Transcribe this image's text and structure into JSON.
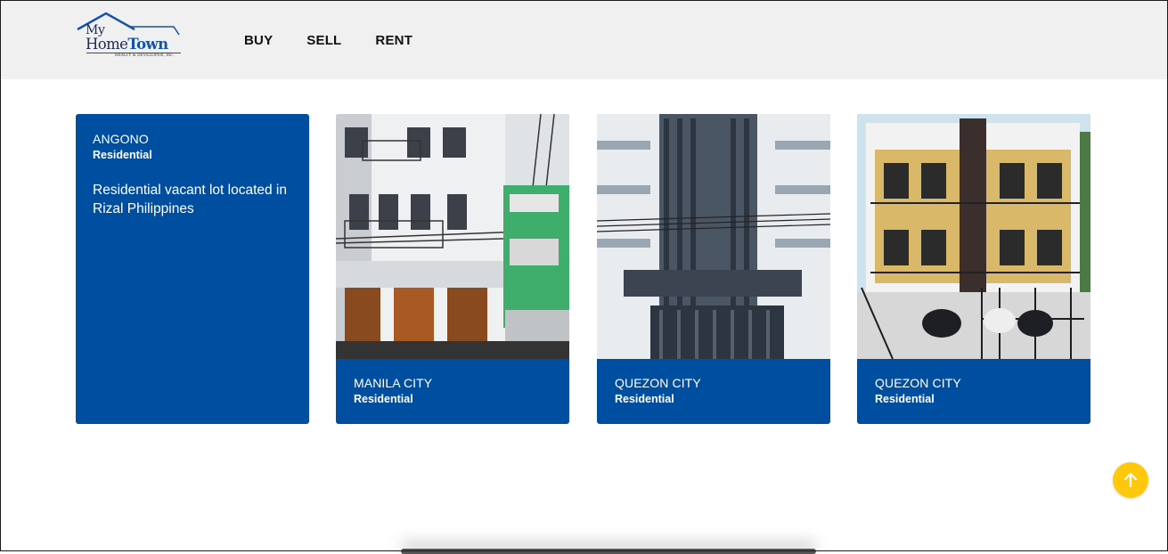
{
  "brand": {
    "logo_line1": "My",
    "logo_home": "Home",
    "logo_town": "Town",
    "logo_tagline": "REALTY & DEVELOPER, Inc."
  },
  "nav": {
    "items": [
      "BUY",
      "SELL",
      "RENT"
    ]
  },
  "listings": [
    {
      "city": "ANGONO",
      "type": "Residential",
      "description": "Residential vacant lot located in Rizal Philippines"
    },
    {
      "city": "MANILA CITY",
      "type": "Residential"
    },
    {
      "city": "QUEZON CITY",
      "type": "Residential"
    },
    {
      "city": "QUEZON CITY",
      "type": "Residential"
    }
  ],
  "icons": {
    "scroll_top": "arrow-up-icon"
  },
  "colors": {
    "card_blue": "#004e9f",
    "accent_yellow": "#ffc80d",
    "header_bg": "#f0f0f0"
  }
}
